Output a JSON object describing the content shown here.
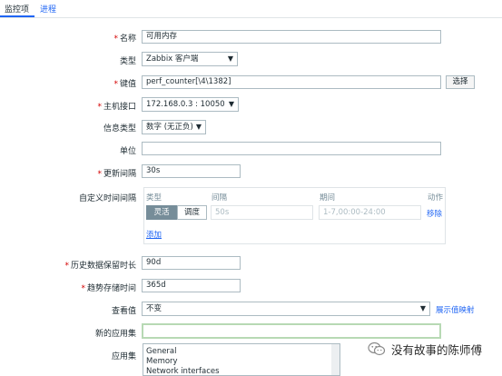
{
  "tabs": {
    "items_tab": "监控项",
    "process_tab": "进程"
  },
  "form": {
    "name": {
      "label": "名称",
      "value": "可用内存"
    },
    "type": {
      "label": "类型",
      "value": "Zabbix 客户端"
    },
    "key": {
      "label": "键值",
      "value": "perf_counter[\\4\\1382]",
      "select_button": "选择"
    },
    "host_interface": {
      "label": "主机接口",
      "value": "172.168.0.3 : 10050"
    },
    "info_type": {
      "label": "信息类型",
      "value": "数字 (无正负)"
    },
    "units": {
      "label": "单位",
      "value": ""
    },
    "update_interval": {
      "label": "更新间隔",
      "value": "30s"
    },
    "custom_intervals": {
      "label": "自定义时间间隔",
      "headers": {
        "type": "类型",
        "interval": "间隔",
        "period": "期间",
        "action": "动作"
      },
      "row": {
        "type_flexible": "灵活",
        "type_scheduling": "调度",
        "interval_placeholder": "50s",
        "period_placeholder": "1-7,00:00-24:00",
        "remove": "移除"
      },
      "add": "添加"
    },
    "history": {
      "label": "历史数据保留时长",
      "value": "90d"
    },
    "trends": {
      "label": "趋势存储时间",
      "value": "365d"
    },
    "show_value": {
      "label": "查看值",
      "value": "不变",
      "mapping_link": "展示值映射"
    },
    "new_application": {
      "label": "新的应用集",
      "value": ""
    },
    "applications": {
      "label": "应用集",
      "options": [
        "General",
        "Memory",
        "Network interfaces"
      ]
    }
  },
  "watermark": {
    "text": "没有故事的陈师傅"
  },
  "colors": {
    "link": "#1f65f4",
    "required": "#d40000",
    "active_segment": "#768d99",
    "focus_border": "#b7d9b4"
  }
}
